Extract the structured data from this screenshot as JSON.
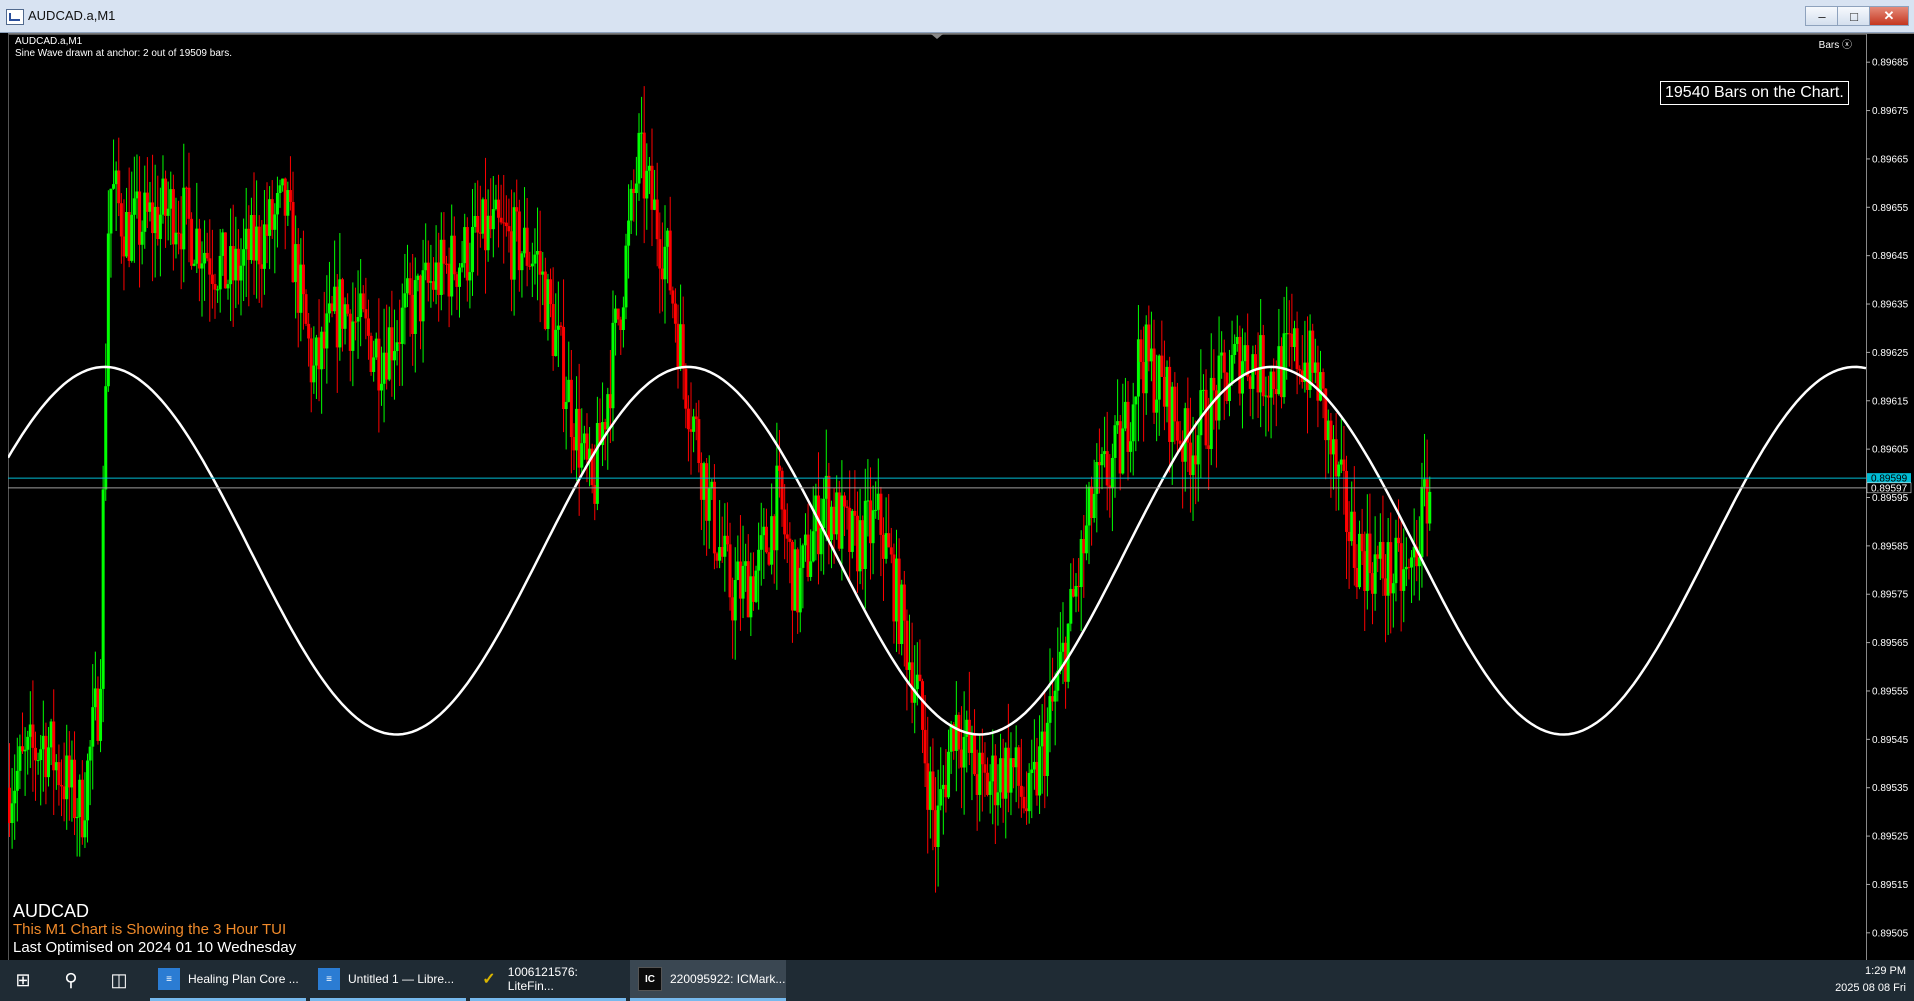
{
  "window": {
    "title": "AUDCAD.a,M1",
    "min_glyph": "–",
    "max_glyph": "□",
    "close_glyph": "✕"
  },
  "chart": {
    "symbol_timeframe": "AUDCAD.a,M1",
    "sine_info": "Sine Wave drawn at anchor: 2 out of 19509 bars.",
    "bars_label": "Bars ⓧ",
    "bars_count_text": "19540 Bars on the Chart.",
    "footer_symbol": "AUDCAD",
    "footer_tui": "This M1 Chart is Showing the 3 Hour TUI",
    "footer_optimised": "Last Optimised on 2024 01 10 Wednesday",
    "colors": {
      "background": "#000000",
      "bull": "#00ff00",
      "bear": "#ff0000",
      "sine": "#ffffff",
      "bid_line": "#00bcd4",
      "ask_line": "#9e9e9e"
    }
  },
  "chart_data": {
    "type": "candlestick",
    "y_axis_ticks": [
      "0.89685",
      "0.89675",
      "0.89665",
      "0.89655",
      "0.89645",
      "0.89635",
      "0.89625",
      "0.89615",
      "0.89605",
      "0.89595",
      "0.89585",
      "0.89575",
      "0.89565",
      "0.89555",
      "0.89545",
      "0.89535",
      "0.89525",
      "0.89515",
      "0.89505"
    ],
    "price_labels": [
      {
        "text": "0.89599",
        "price": 0.89599,
        "color": "#00bcd4"
      },
      {
        "text": "0.89597",
        "price": 0.89597,
        "color": "#ffffff"
      }
    ],
    "ylim": [
      0.895,
      0.8969
    ],
    "price_path": [
      {
        "t": 0,
        "price": 0.89535
      },
      {
        "t": 0.02,
        "price": 0.89545
      },
      {
        "t": 0.04,
        "price": 0.8953
      },
      {
        "t": 0.05,
        "price": 0.89555
      },
      {
        "t": 0.055,
        "price": 0.8966
      },
      {
        "t": 0.065,
        "price": 0.8965
      },
      {
        "t": 0.09,
        "price": 0.89655
      },
      {
        "t": 0.12,
        "price": 0.8964
      },
      {
        "t": 0.15,
        "price": 0.89655
      },
      {
        "t": 0.165,
        "price": 0.8962
      },
      {
        "t": 0.18,
        "price": 0.89635
      },
      {
        "t": 0.2,
        "price": 0.89625
      },
      {
        "t": 0.23,
        "price": 0.8964
      },
      {
        "t": 0.26,
        "price": 0.8965
      },
      {
        "t": 0.285,
        "price": 0.89645
      },
      {
        "t": 0.3,
        "price": 0.8962
      },
      {
        "t": 0.315,
        "price": 0.89595
      },
      {
        "t": 0.33,
        "price": 0.89635
      },
      {
        "t": 0.34,
        "price": 0.89665
      },
      {
        "t": 0.355,
        "price": 0.89645
      },
      {
        "t": 0.365,
        "price": 0.8962
      },
      {
        "t": 0.38,
        "price": 0.8959
      },
      {
        "t": 0.39,
        "price": 0.89575
      },
      {
        "t": 0.405,
        "price": 0.8958
      },
      {
        "t": 0.415,
        "price": 0.89595
      },
      {
        "t": 0.425,
        "price": 0.89575
      },
      {
        "t": 0.44,
        "price": 0.89595
      },
      {
        "t": 0.455,
        "price": 0.89585
      },
      {
        "t": 0.47,
        "price": 0.8959
      },
      {
        "t": 0.49,
        "price": 0.89555
      },
      {
        "t": 0.5,
        "price": 0.89525
      },
      {
        "t": 0.51,
        "price": 0.8955
      },
      {
        "t": 0.525,
        "price": 0.89535
      },
      {
        "t": 0.54,
        "price": 0.8954
      },
      {
        "t": 0.55,
        "price": 0.8953
      },
      {
        "t": 0.565,
        "price": 0.89555
      },
      {
        "t": 0.585,
        "price": 0.89595
      },
      {
        "t": 0.6,
        "price": 0.89605
      },
      {
        "t": 0.61,
        "price": 0.89625
      },
      {
        "t": 0.625,
        "price": 0.89615
      },
      {
        "t": 0.635,
        "price": 0.89605
      },
      {
        "t": 0.65,
        "price": 0.89615
      },
      {
        "t": 0.665,
        "price": 0.89625
      },
      {
        "t": 0.68,
        "price": 0.8962
      },
      {
        "t": 0.695,
        "price": 0.89625
      },
      {
        "t": 0.705,
        "price": 0.8962
      },
      {
        "t": 0.715,
        "price": 0.896
      },
      {
        "t": 0.725,
        "price": 0.89585
      },
      {
        "t": 0.74,
        "price": 0.8958
      },
      {
        "t": 0.755,
        "price": 0.89578
      },
      {
        "t": 0.765,
        "price": 0.89597
      }
    ],
    "sine_wave": {
      "period_fraction": 0.314,
      "peak_t": 0.052,
      "center_price": 0.89584,
      "amplitude": 0.00038
    }
  },
  "taskbar": {
    "start_glyph": "⊞",
    "search_glyph": "⚲",
    "taskview_glyph": "◫",
    "apps": [
      {
        "label": "Healing Plan Core ...",
        "glyph": "≡",
        "color": "#2b7cd3"
      },
      {
        "label": "Untitled 1 — Libre...",
        "glyph": "≡",
        "color": "#2b7cd3"
      },
      {
        "label": "1006121576: LiteFin...",
        "glyph": "✓",
        "color": "#d8b400"
      },
      {
        "label": "220095922: ICMark...",
        "glyph": "IC",
        "color": "#ffffff"
      }
    ],
    "time": "1:29 PM",
    "date": "2025 08 08 Fri"
  }
}
